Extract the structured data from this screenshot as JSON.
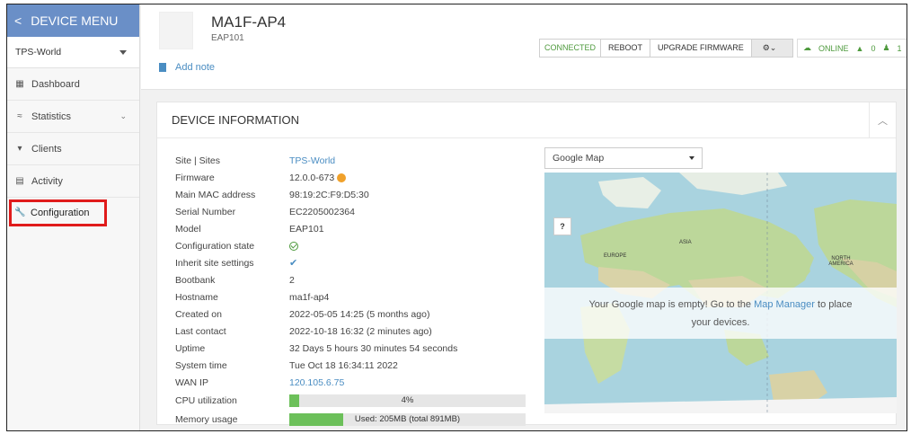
{
  "sidebar": {
    "menu_title": "DEVICE MENU",
    "back_glyph": "<",
    "site": "TPS-World",
    "items": [
      {
        "label": "Dashboard",
        "icon": "dashboard-icon"
      },
      {
        "label": "Statistics",
        "icon": "statistics-icon"
      },
      {
        "label": "Clients",
        "icon": "wifi-icon"
      },
      {
        "label": "Activity",
        "icon": "activity-icon"
      },
      {
        "label": "Configuration",
        "icon": "wrench-icon"
      }
    ]
  },
  "header": {
    "device_name": "MA1F-AP4",
    "device_model": "EAP101",
    "add_note": "Add note",
    "connected": "CONNECTED",
    "reboot": "REBOOT",
    "upgrade": "UPGRADE FIRMWARE",
    "online": "ONLINE",
    "alerts": "0",
    "users": "1"
  },
  "panel": {
    "title": "DEVICE INFORMATION",
    "info": [
      {
        "label": "Site | Sites",
        "value": "TPS-World"
      },
      {
        "label": "Firmware",
        "value": "12.0.0-673"
      },
      {
        "label": "Main MAC address",
        "value": "98:19:2C:F9:D5:30"
      },
      {
        "label": "Serial Number",
        "value": "EC2205002364"
      },
      {
        "label": "Model",
        "value": "EAP101"
      },
      {
        "label": "Configuration state",
        "value": ""
      },
      {
        "label": "Inherit site settings",
        "value": ""
      },
      {
        "label": "Bootbank",
        "value": "2"
      },
      {
        "label": "Hostname",
        "value": "ma1f-ap4"
      },
      {
        "label": "Created on",
        "value": "2022-05-05 14:25 (5 months ago)"
      },
      {
        "label": "Last contact",
        "value": "2022-10-18 16:32 (2 minutes ago)"
      },
      {
        "label": "Uptime",
        "value": "32 Days 5 hours 30 minutes 54 seconds"
      },
      {
        "label": "System time",
        "value": "Tue Oct 18 16:34:11 2022"
      },
      {
        "label": "WAN IP",
        "value": "120.105.6.75"
      },
      {
        "label": "CPU utilization",
        "value": "4%"
      },
      {
        "label": "Memory usage",
        "value": "Used: 205MB (total 891MB)"
      }
    ],
    "cpu_fraction": 0.04,
    "mem_fraction": 0.23
  },
  "map": {
    "selector": "Google Map",
    "help": "?",
    "empty_msg_1": "Your Google map is empty! Go to the ",
    "empty_link": "Map Manager",
    "empty_msg_2": " to place",
    "empty_msg_3": "your devices.",
    "labels": {
      "europe": "EUROPE",
      "asia": "ASIA",
      "north_america": "NORTH AMERICA"
    }
  }
}
